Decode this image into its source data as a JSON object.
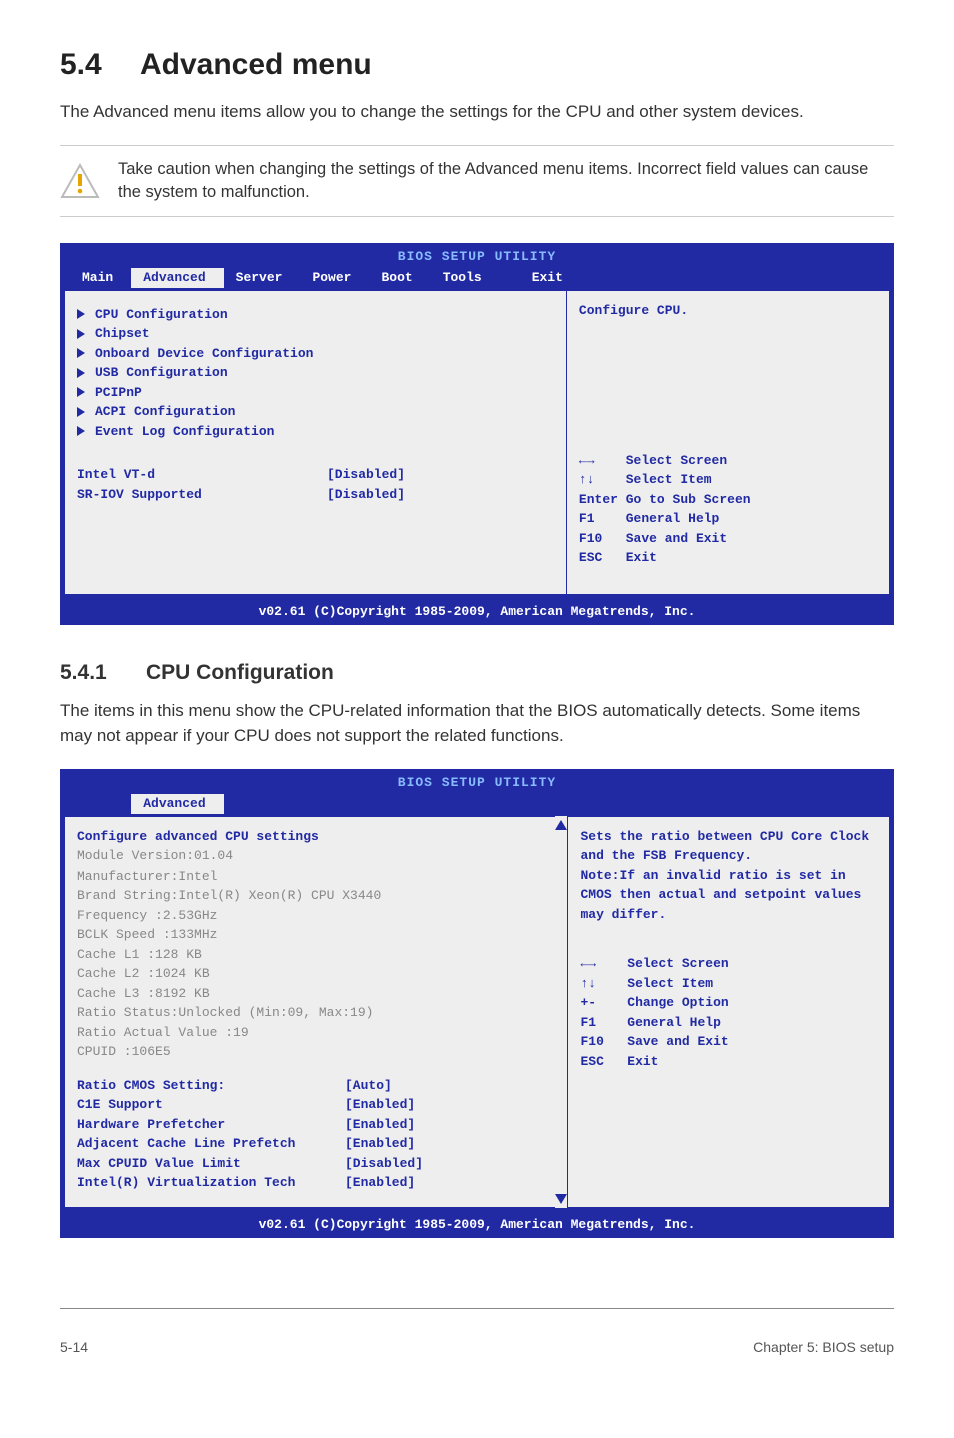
{
  "heading": {
    "num": "5.4",
    "title": "Advanced menu"
  },
  "intro": "The Advanced menu items allow you to change the settings for the CPU and other system devices.",
  "caution": "Take caution when changing the settings of the Advanced menu items. Incorrect field values can cause the system to malfunction.",
  "bios1": {
    "header": "BIOS SETUP UTILITY",
    "tabs": [
      "Main",
      "Advanced",
      "Server",
      "Power",
      "Boot",
      "Tools",
      "Exit"
    ],
    "selectedTab": "Advanced",
    "menu": [
      "CPU Configuration",
      "Chipset",
      "Onboard Device Configuration",
      "USB Configuration",
      "PCIPnP",
      "ACPI Configuration",
      "Event Log Configuration"
    ],
    "settings": [
      {
        "label": "Intel VT-d",
        "value": "[Disabled]"
      },
      {
        "label": "SR-IOV Supported",
        "value": "[Disabled]"
      }
    ],
    "help": "Configure CPU.",
    "nav": [
      "←→    Select Screen",
      "↑↓    Select Item",
      "Enter Go to Sub Screen",
      "F1    General Help",
      "F10   Save and Exit",
      "ESC   Exit"
    ],
    "footer": "v02.61 (C)Copyright 1985-2009, American Megatrends, Inc."
  },
  "sub": {
    "num": "5.4.1",
    "title": "CPU Configuration",
    "para": "The items in this menu show the CPU-related information that the BIOS automatically detects. Some items may not appear if your CPU does not support the related functions."
  },
  "bios2": {
    "header": "BIOS SETUP UTILITY",
    "selectedTab": "Advanced",
    "topline": "Configure advanced CPU settings",
    "grey": [
      "Module Version:01.04",
      "Manufacturer:Intel",
      "Brand String:Intel(R) Xeon(R)  CPU           X3440",
      "Frequency    :2.53GHz",
      "BCLK Speed   :133MHz",
      "Cache L1     :128 KB",
      "Cache L2     :1024 KB",
      "Cache L3     :8192 KB",
      "Ratio Status:Unlocked (Min:09, Max:19)",
      "Ratio Actual Value  :19",
      "CPUID        :106E5"
    ],
    "settings": [
      {
        "label": "Ratio CMOS Setting:",
        "value": "[Auto]"
      },
      {
        "label": "C1E Support",
        "value": "[Enabled]"
      },
      {
        "label": "Hardware Prefetcher",
        "value": "[Enabled]"
      },
      {
        "label": "Adjacent Cache Line Prefetch",
        "value": "[Enabled]"
      },
      {
        "label": "Max CPUID Value Limit",
        "value": "[Disabled]"
      },
      {
        "label": "Intel(R) Virtualization Tech",
        "value": "[Enabled]"
      }
    ],
    "help": "Sets the ratio between CPU Core Clock and the FSB Frequency.\nNote:If an invalid ratio is set in CMOS then actual and setpoint values may differ.",
    "nav": [
      "←→    Select Screen",
      "↑↓    Select Item",
      "+-    Change Option",
      "F1    General Help",
      "F10   Save and Exit",
      "ESC   Exit"
    ],
    "footer": "v02.61 (C)Copyright 1985-2009, American Megatrends, Inc."
  },
  "pagefoot": {
    "left": "5-14",
    "right": "Chapter 5: BIOS setup"
  }
}
